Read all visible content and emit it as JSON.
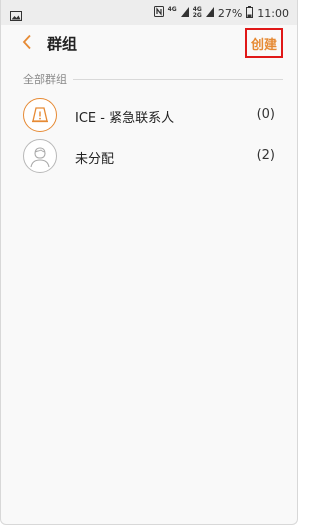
{
  "status_bar": {
    "network_top": "4G",
    "network_bottom": "4G",
    "network_bottom2": "2G",
    "battery": "27%",
    "time": "11:00"
  },
  "app_bar": {
    "title": "群组",
    "create_label": "创建"
  },
  "section": {
    "label": "全部群组"
  },
  "groups": [
    {
      "label": "ICE - 紧急联系人",
      "count": "(0)",
      "icon": "warning-icon"
    },
    {
      "label": "未分配",
      "count": "(2)",
      "icon": "person-icon"
    }
  ],
  "colors": {
    "accent": "#e68a34",
    "highlight_border": "#e01818"
  }
}
